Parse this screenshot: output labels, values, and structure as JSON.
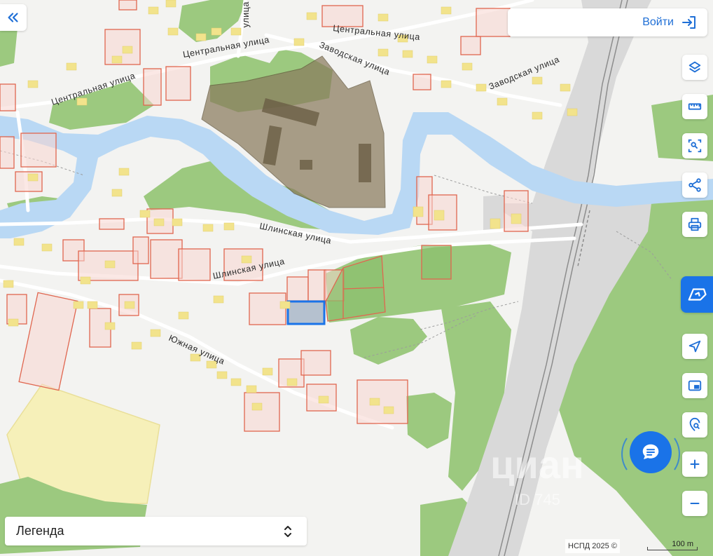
{
  "map": {
    "streets": [
      {
        "id": "central-1",
        "name": "Центральная улица"
      },
      {
        "id": "central-2",
        "name": "Центральная улица"
      },
      {
        "id": "central-3",
        "name": "Центральная улица"
      },
      {
        "id": "zavodskaya-1",
        "name": "Заводская улица"
      },
      {
        "id": "zavodskaya-2",
        "name": "Заводская улица"
      },
      {
        "id": "shlinskaya-1",
        "name": "Шлинская улица"
      },
      {
        "id": "shlinskaya-2",
        "name": "Шлинская улица"
      },
      {
        "id": "yuzhnaya",
        "name": "Южная улица"
      },
      {
        "id": "vertical",
        "name": "улица"
      }
    ],
    "colors": {
      "background": "#f3f3f1",
      "river": "#b9d8f4",
      "forest": "#9cc97f",
      "rail_zone": "#d6d6d6",
      "parcel_stroke": "#e0664f",
      "parcel_fill": "#f7d6cf",
      "building": "#f2e38c",
      "selected_parcel": "#1a73e8",
      "protected_area": "#8a7b5d",
      "field": "#f7f0b0"
    }
  },
  "ui": {
    "login_label": "Войти",
    "legend_label": "Легенда",
    "attribution": "НСПД 2025 ©",
    "scale_label": "100 m",
    "watermark": "циан",
    "watermark_id": "ID 745"
  },
  "controls": [
    {
      "name": "layers-button",
      "icon": "layers-icon"
    },
    {
      "name": "ruler-button",
      "icon": "ruler-icon"
    },
    {
      "name": "area-select-button",
      "icon": "area-select-icon"
    },
    {
      "name": "share-button",
      "icon": "share-icon"
    },
    {
      "name": "print-button",
      "icon": "printer-icon"
    },
    {
      "name": "special-tool-button",
      "icon": "map-tool-icon"
    },
    {
      "name": "locate-button",
      "icon": "location-arrow-icon"
    },
    {
      "name": "picture-in-picture-button",
      "icon": "picture-in-picture-icon"
    },
    {
      "name": "geo-search-button",
      "icon": "geo-search-icon"
    },
    {
      "name": "zoom-in-button",
      "icon": "plus-icon"
    },
    {
      "name": "zoom-out-button",
      "icon": "minus-icon"
    }
  ]
}
